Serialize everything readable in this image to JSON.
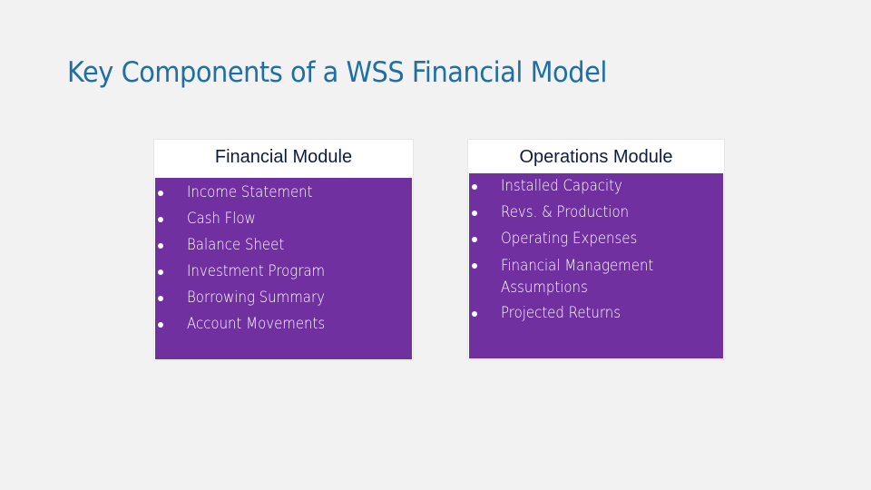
{
  "slide": {
    "title": "Key Components of a WSS Financial Model"
  },
  "modules": [
    {
      "heading": "Financial Module",
      "items": [
        "Income Statement",
        "Cash Flow",
        "Balance Sheet",
        "Investment Program",
        "Borrowing Summary",
        "Account Movements"
      ]
    },
    {
      "heading": "Operations Module",
      "items": [
        "Installed Capacity",
        "Revs. & Production",
        "Operating Expenses",
        "Financial Management Assumptions",
        "Projected Returns"
      ]
    }
  ],
  "colors": {
    "title": "#1e6fa3",
    "card_body": "#7030a0",
    "heading": "#0d1b3e"
  }
}
